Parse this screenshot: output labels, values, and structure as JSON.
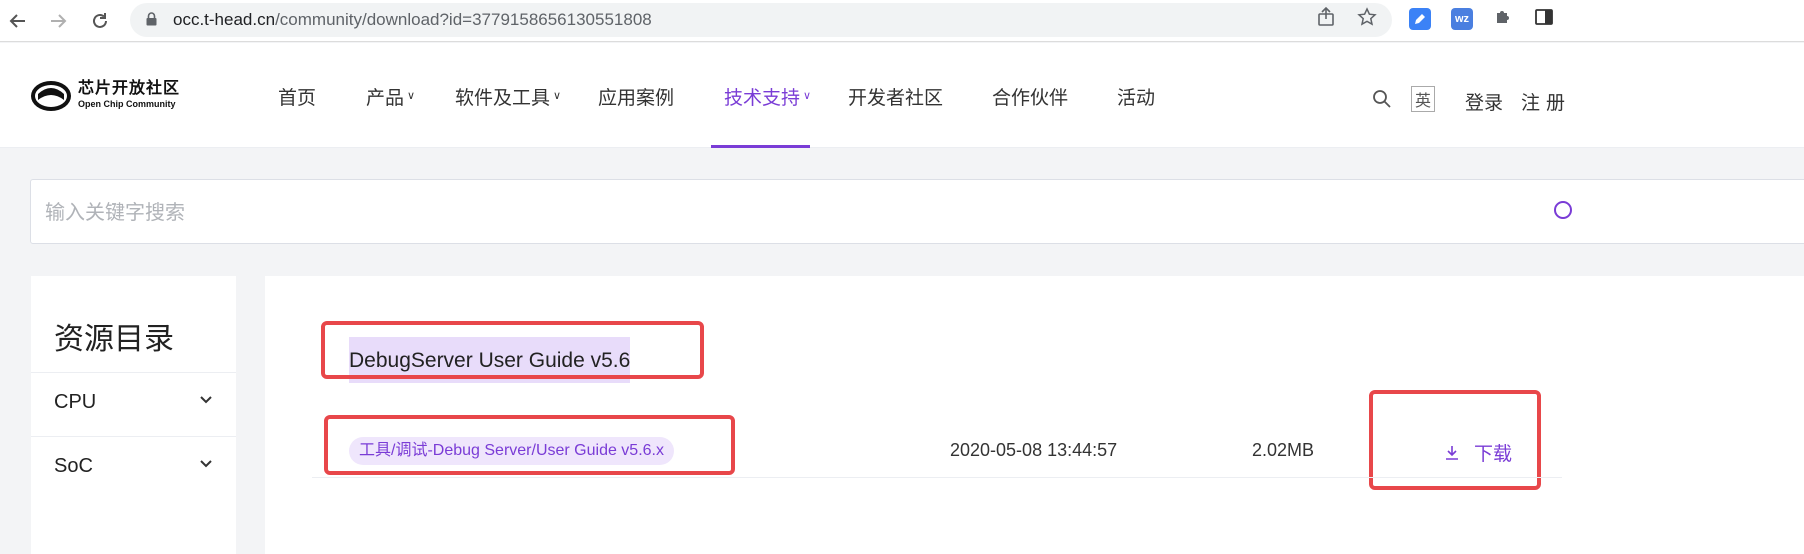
{
  "browser": {
    "url_host": "occ.t-head.cn",
    "url_path": "/community/download?id=3779158656130551808"
  },
  "header": {
    "logo_cn": "芯片开放社区",
    "logo_en": "Open Chip Community",
    "nav": [
      {
        "label": "首页",
        "dropdown": false
      },
      {
        "label": "产品",
        "dropdown": true
      },
      {
        "label": "软件及工具",
        "dropdown": true
      },
      {
        "label": "应用案例",
        "dropdown": false
      },
      {
        "label": "技术支持",
        "dropdown": true,
        "active": true
      },
      {
        "label": "开发者社区",
        "dropdown": false
      },
      {
        "label": "合作伙伴",
        "dropdown": false
      },
      {
        "label": "活动",
        "dropdown": false
      }
    ],
    "lang_label": "英",
    "login_label": "登录",
    "register_label": "注册"
  },
  "search": {
    "placeholder": "输入关键字搜索"
  },
  "sidebar": {
    "title": "资源目录",
    "items": [
      {
        "label": "CPU"
      },
      {
        "label": "SoC"
      }
    ]
  },
  "document": {
    "title": "DebugServer User Guide v5.6",
    "rows": [
      {
        "tag": "工具/调试-Debug Server/User Guide v5.6.x",
        "date": "2020-05-08 13:44:57",
        "size": "2.02MB",
        "download_label": "下载"
      }
    ]
  },
  "colors": {
    "accent": "#7a3cd6",
    "highlight_box": "#e8474a",
    "title_highlight": "#e8dcfa"
  }
}
